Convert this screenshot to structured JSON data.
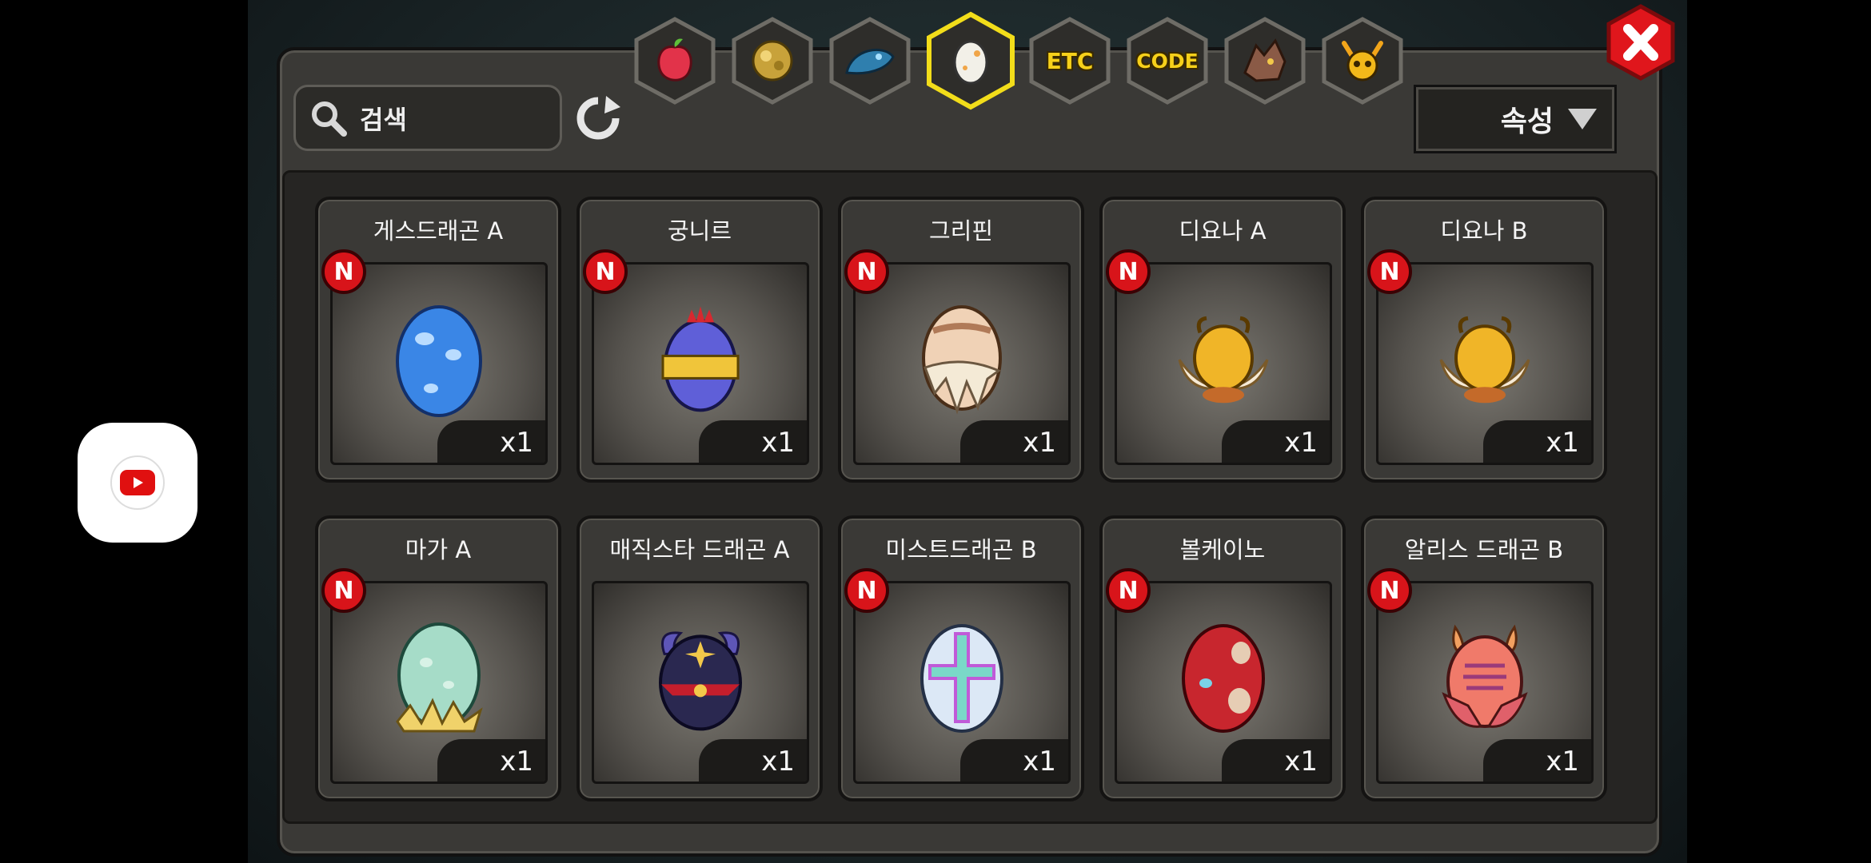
{
  "search": {
    "placeholder": "검색"
  },
  "sort": {
    "label": "속성"
  },
  "tabs": [
    {
      "name": "fruit",
      "icon": "red-fruit-icon",
      "selected": false
    },
    {
      "name": "ore",
      "icon": "gold-ore-icon",
      "selected": false
    },
    {
      "name": "scale",
      "icon": "blue-scale-icon",
      "selected": false
    },
    {
      "name": "egg",
      "icon": "egg-icon",
      "selected": true
    },
    {
      "name": "etc",
      "label": "ETC",
      "selected": false
    },
    {
      "name": "code",
      "label": "CODE",
      "selected": false
    },
    {
      "name": "dragon",
      "icon": "dragon-head-icon",
      "selected": false
    },
    {
      "name": "pet",
      "icon": "horned-face-icon",
      "selected": false
    }
  ],
  "items": [
    {
      "name": "게스드래곤 A",
      "qty": "x1",
      "badge": "N",
      "egg": "blue-spotted"
    },
    {
      "name": "궁니르",
      "qty": "x1",
      "badge": "N",
      "egg": "crowned-purple"
    },
    {
      "name": "그리핀",
      "qty": "x1",
      "badge": "N",
      "egg": "feathered-cream"
    },
    {
      "name": "디요나 A",
      "qty": "x1",
      "badge": "N",
      "egg": "winged-gold"
    },
    {
      "name": "디요나 B",
      "qty": "x1",
      "badge": "N",
      "egg": "winged-gold"
    },
    {
      "name": "마가 A",
      "qty": "x1",
      "badge": "N",
      "egg": "mint-nest"
    },
    {
      "name": "매직스타 드래곤 A",
      "qty": "x1",
      "badge": "N",
      "egg": "horned-navy"
    },
    {
      "name": "미스트드래곤 B",
      "qty": "x1",
      "badge": "N",
      "egg": "cross-pale-blue"
    },
    {
      "name": "볼케이노",
      "qty": "x1",
      "badge": "N",
      "egg": "red-spotted"
    },
    {
      "name": "알리스 드래곤 B",
      "qty": "x1",
      "badge": "N",
      "egg": "pink-winged"
    }
  ],
  "colors": {
    "accent": "#f6d01a",
    "badge_red": "#d8141a",
    "close_red": "#e0161c"
  }
}
